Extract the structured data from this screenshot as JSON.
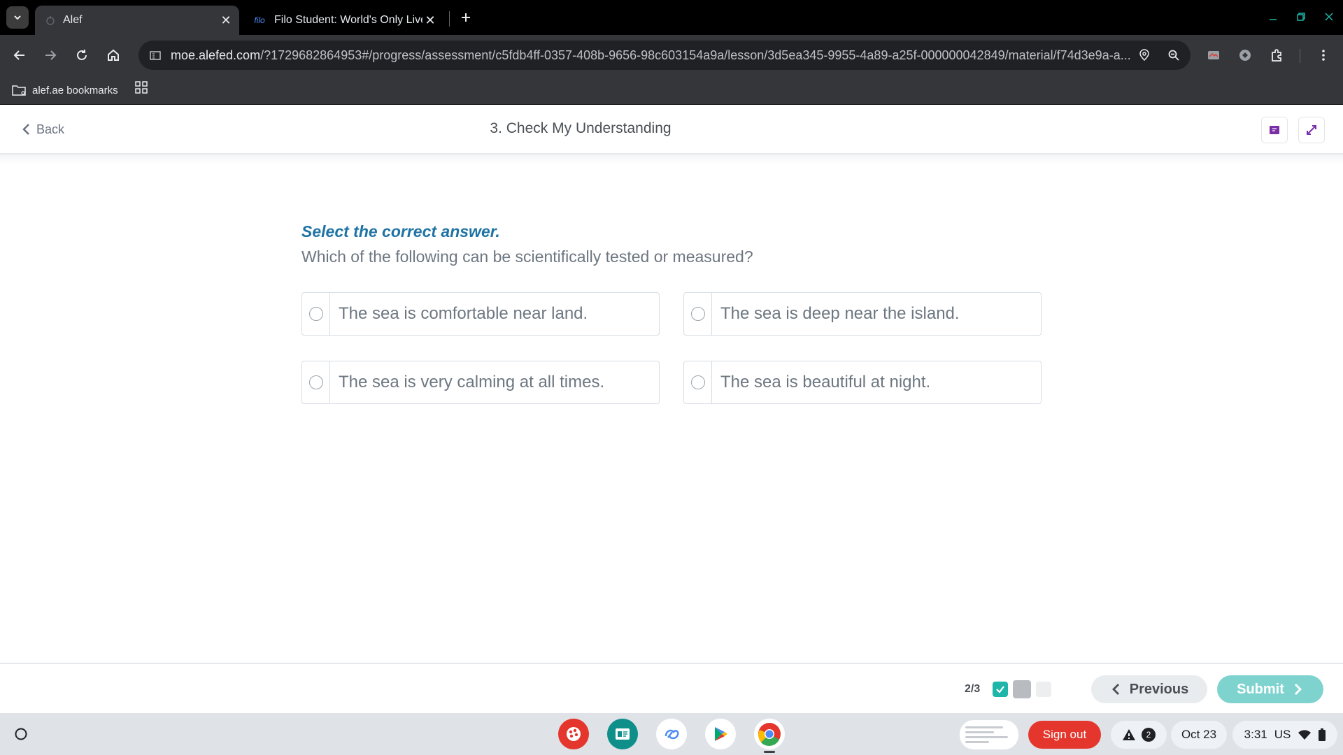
{
  "browser": {
    "tabs": [
      {
        "title": "Alef",
        "active": true
      },
      {
        "title": "Filo Student: World's Only Live I",
        "favicon_text": "filo",
        "active": false
      }
    ],
    "url": {
      "host": "moe.alefed.com",
      "path": "/?1729682864953#/progress/assessment/c5fdb4ff-0357-408b-9656-98c603154a9a/lesson/3d5ea345-9955-4a89-a25f-000000042849/material/f74d3e9a-a..."
    },
    "bookmarks": [
      {
        "label": "alef.ae bookmarks",
        "icon": "folder-icon"
      }
    ]
  },
  "header": {
    "back_label": "Back",
    "title": "3. Check My Understanding"
  },
  "question": {
    "instruction": "Select the correct answer.",
    "prompt": "Which of the following can be scientifically tested or measured?",
    "options": [
      {
        "label": "The sea is comfortable near land."
      },
      {
        "label": "The sea is deep near the island."
      },
      {
        "label": "The sea is very calming at all times."
      },
      {
        "label": "The sea is beautiful at night."
      }
    ]
  },
  "footer": {
    "progress_label": "2/3",
    "previous_label": "Previous",
    "submit_label": "Submit"
  },
  "shelf": {
    "sign_out_label": "Sign out",
    "notification_count": "2",
    "date": "Oct 23",
    "time": "3:31",
    "locale": "US"
  },
  "colors": {
    "accent_blue": "#1e73a4",
    "submit_teal": "#7ed3cf",
    "check_green": "#1fb5a9",
    "sign_out_red": "#e4362c"
  }
}
